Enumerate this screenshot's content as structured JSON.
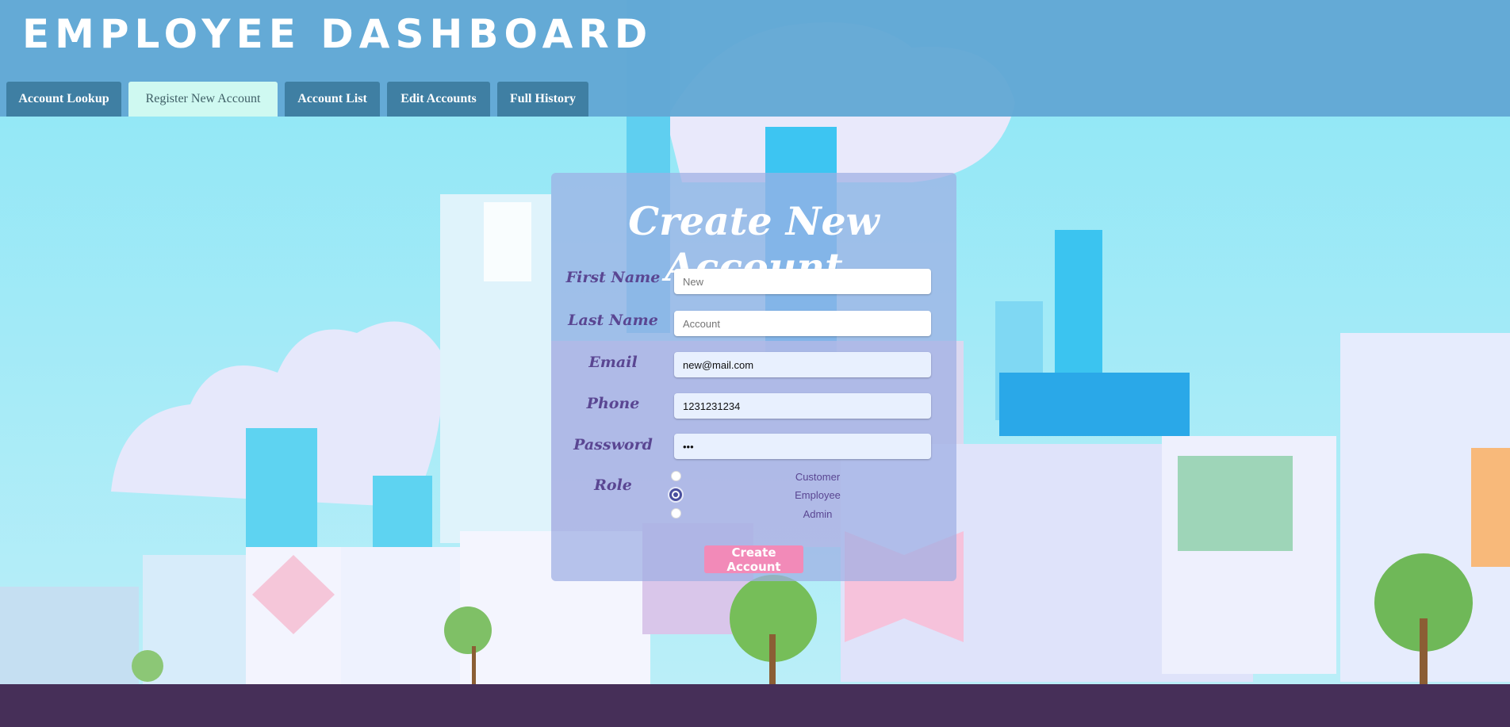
{
  "header": {
    "title": "EMPLOYEE  DASHBOARD",
    "tabs": [
      {
        "label": "Account Lookup"
      },
      {
        "label": "Register New Account"
      },
      {
        "label": "Account List"
      },
      {
        "label": "Edit Accounts"
      },
      {
        "label": "Full History"
      }
    ],
    "active_tab": "Register New Account"
  },
  "form": {
    "title": "Create New Account",
    "first_name": {
      "label": "First Name",
      "placeholder": "New"
    },
    "last_name": {
      "label": "Last Name",
      "placeholder": "Account"
    },
    "email": {
      "label": "Email",
      "value": "new@mail.com"
    },
    "phone": {
      "label": "Phone",
      "value": "1231231234"
    },
    "password": {
      "label": "Password",
      "value": "•••"
    },
    "role": {
      "label": "Role",
      "options": [
        "Customer",
        "Employee",
        "Admin"
      ],
      "selected": "Employee"
    },
    "submit_label": "Create Account"
  },
  "colors": {
    "header_bg": "#62a8d4",
    "tab_bg": "#3f7fa3",
    "active_tab_bg": "#cff9f1",
    "card_bg": "#9eafe3",
    "label_color": "#5a4692",
    "button_bg": "#f28ab8",
    "footer_bg": "#462f58",
    "sky": "#8fe3f5"
  }
}
